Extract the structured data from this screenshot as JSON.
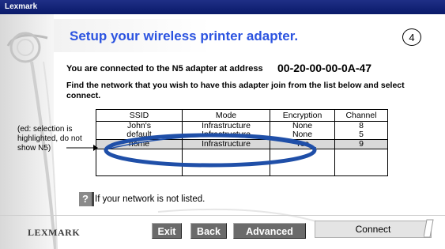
{
  "window": {
    "title": "Lexmark"
  },
  "header": {
    "title": "Setup your wireless printer adapter.",
    "step": "4"
  },
  "connection": {
    "text": "You are connected to the N5 adapter at address",
    "mac_address": "00-20-00-00-0A-47"
  },
  "instructions": "Find the network that you wish to have this adapter join from the list below and select connect.",
  "table": {
    "headers": [
      "SSID",
      "Mode",
      "Encryption",
      "Channel"
    ],
    "rows": [
      {
        "ssid": "John's",
        "mode": "Infrastructure",
        "encryption": "None",
        "channel": "8"
      },
      {
        "ssid": "default",
        "mode": "Infrastructure",
        "encryption": "None",
        "channel": "5"
      },
      {
        "ssid": "home",
        "mode": "Infrastructure",
        "encryption": "Yes",
        "channel": "9",
        "selected": true
      }
    ]
  },
  "annotation": "(ed: selection is highlighted, do not show N5)",
  "help": {
    "icon_label": "?",
    "text": "If your network is not listed."
  },
  "footer": {
    "logo": "LEXMARK",
    "exit_label": "Exit",
    "back_label": "Back",
    "advanced_label": "Advanced",
    "connect_label": "Connect"
  },
  "colors": {
    "title_blue": "#2b53e0",
    "titlebar": "#0a1a6a",
    "button_gray": "#6b6b6b",
    "oval_blue": "#1f4fa8"
  }
}
